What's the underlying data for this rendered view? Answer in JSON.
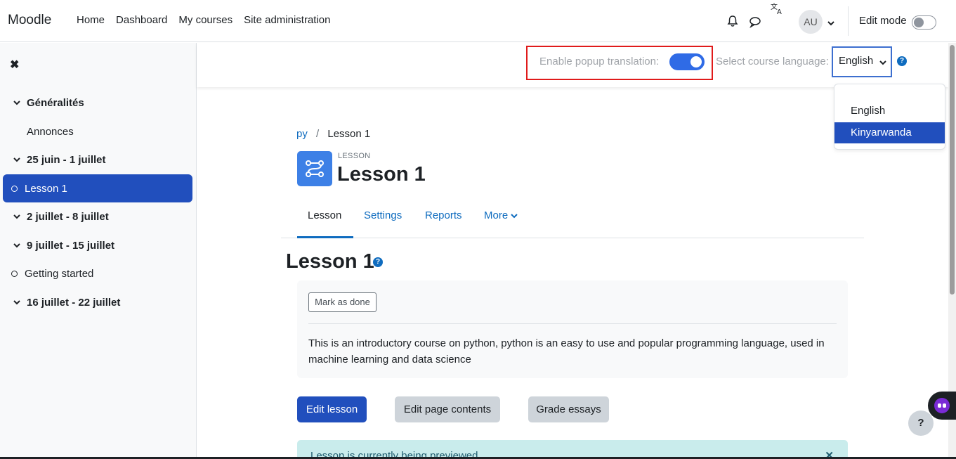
{
  "navbar": {
    "brand": "Moodle",
    "links": [
      "Home",
      "Dashboard",
      "My courses",
      "Site administration"
    ],
    "avatar_initials": "AU",
    "edit_mode_label": "Edit mode"
  },
  "drawer": {
    "items": [
      {
        "label": "Généralités",
        "type": "section"
      },
      {
        "label": "Annonces",
        "type": "activity"
      },
      {
        "label": "25 juin - 1 juillet",
        "type": "section"
      },
      {
        "label": "Lesson 1",
        "type": "activity-active"
      },
      {
        "label": "2 juillet - 8 juillet",
        "type": "section"
      },
      {
        "label": "9 juillet - 15 juillet",
        "type": "section"
      },
      {
        "label": "Getting started",
        "type": "activity"
      },
      {
        "label": "16 juillet - 22 juillet",
        "type": "section"
      }
    ]
  },
  "translation": {
    "popup_label": "Enable popup translation:",
    "popup_enabled": true,
    "language_label": "Select course language:",
    "selected_language": "English",
    "options": [
      "English",
      "Kinyarwanda"
    ],
    "highlighted_option": "Kinyarwanda"
  },
  "breadcrumb": {
    "course": "py",
    "separator": "/",
    "current": "Lesson 1"
  },
  "header": {
    "activity_type": "LESSON",
    "title": "Lesson 1"
  },
  "tabs": [
    {
      "label": "Lesson",
      "active": true
    },
    {
      "label": "Settings"
    },
    {
      "label": "Reports"
    },
    {
      "label": "More"
    }
  ],
  "main": {
    "section_title": "Lesson 1",
    "mark_done_label": "Mark as done",
    "description": "This is an introductory course on python, python is an easy to use and popular  programming language, used in machine learning and data science",
    "buttons": {
      "edit_lesson": "Edit lesson",
      "edit_page_contents": "Edit page contents",
      "grade_essays": "Grade essays"
    },
    "alert_text": "Lesson is currently being previewed."
  },
  "floating": {
    "help_label": "?"
  },
  "colors": {
    "primary": "#214fbd",
    "link": "#0f6cbf",
    "highlight_border": "#e01b1b",
    "switch_on": "#2f6be6"
  }
}
